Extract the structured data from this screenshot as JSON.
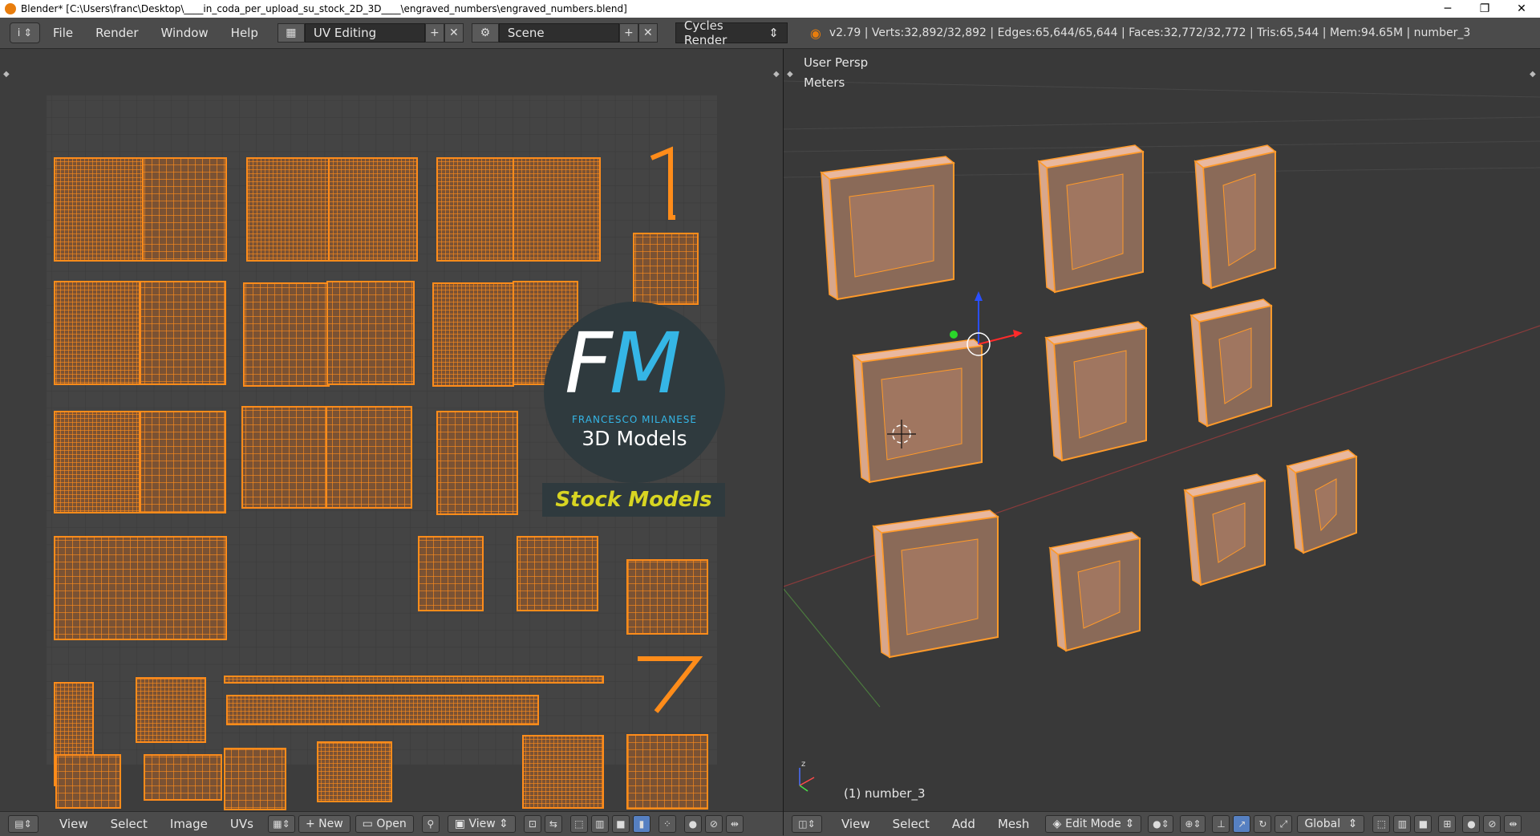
{
  "window": {
    "title": "Blender* [C:\\Users\\franc\\Desktop\\____in_coda_per_upload_su_stock_2D_3D____\\engraved_numbers\\engraved_numbers.blend]",
    "minimize": "─",
    "maximize": "❐",
    "close": "✕"
  },
  "infobar": {
    "editor_icon": "i",
    "menus": [
      "File",
      "Render",
      "Window",
      "Help"
    ],
    "screen_layout": "UV Editing",
    "scene": "Scene",
    "render_engine": "Cycles Render",
    "stats": "v2.79 | Verts:32,892/32,892 | Edges:65,644/65,644 | Faces:32,772/32,772 | Tris:65,544 | Mem:94.65M | number_3",
    "add_symbol": "+",
    "remove_symbol": "✕"
  },
  "uv_editor": {
    "bottom": {
      "menus": [
        "View",
        "Select",
        "Image",
        "UVs"
      ],
      "new_label": "New",
      "open_label": "Open",
      "view_label": "View"
    },
    "logo": {
      "letter_f": "F",
      "letter_m": "M",
      "name": "FRANCESCO MILANESE",
      "sub": "3D Models",
      "stock": "Stock Models"
    }
  },
  "viewport": {
    "perspective": "User Persp",
    "units": "Meters",
    "object_label": "(1) number_3",
    "bottom": {
      "menus": [
        "View",
        "Select",
        "Add",
        "Mesh"
      ],
      "mode": "Edit Mode",
      "orientation": "Global"
    }
  },
  "colors": {
    "uv_orange": "#ff8c1a",
    "mesh_face": "#c8927a",
    "accent_blue": "#5680c2"
  }
}
